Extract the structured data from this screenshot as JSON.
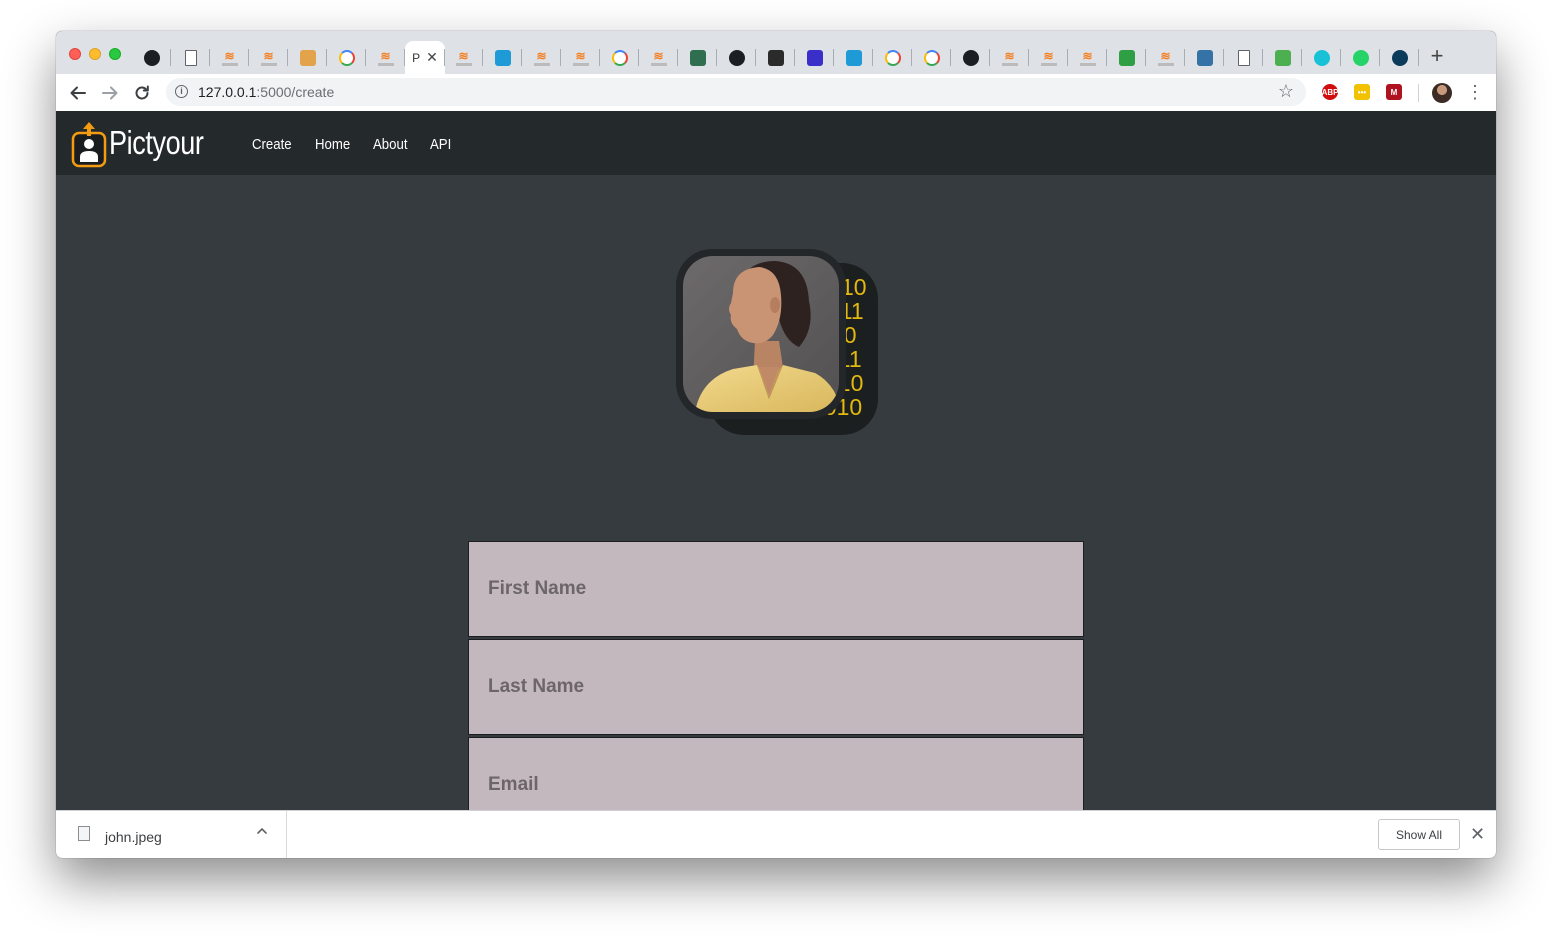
{
  "browser": {
    "active_tab_label": "P",
    "tab_close_glyph": "✕",
    "new_tab_glyph": "+",
    "tabs": [
      {
        "icon": "github-icon",
        "color": "#1b1f23"
      },
      {
        "icon": "document-icon",
        "color": "#5f6368"
      },
      {
        "icon": "stackoverflow-icon",
        "color": "#f48024"
      },
      {
        "icon": "stackoverflow-icon",
        "color": "#f48024"
      },
      {
        "icon": "note-icon",
        "color": "#e3a34a"
      },
      {
        "icon": "google-icon",
        "color": "#4285f4"
      },
      {
        "icon": "stackoverflow-icon",
        "color": "#f48024"
      },
      {
        "icon": "active-tab",
        "color": "#ffffff"
      },
      {
        "icon": "stackoverflow-icon",
        "color": "#f48024"
      },
      {
        "icon": "bird-icon",
        "color": "#1e9bd7"
      },
      {
        "icon": "stackoverflow-icon",
        "color": "#f48024"
      },
      {
        "icon": "stackoverflow-icon",
        "color": "#f48024"
      },
      {
        "icon": "google-icon",
        "color": "#4285f4"
      },
      {
        "icon": "stackoverflow-icon",
        "color": "#f48024"
      },
      {
        "icon": "diamond-icon",
        "color": "#2f6f4f"
      },
      {
        "icon": "dn-icon",
        "color": "#1b1f23"
      },
      {
        "icon": "person-icon",
        "color": "#2b2b2b"
      },
      {
        "icon": "dans-tools-icon",
        "color": "#3a2fc8"
      },
      {
        "icon": "bird-icon",
        "color": "#1e9bd7"
      },
      {
        "icon": "google-icon",
        "color": "#4285f4"
      },
      {
        "icon": "google-icon",
        "color": "#4285f4"
      },
      {
        "icon": "github-icon",
        "color": "#1b1f23"
      },
      {
        "icon": "stackoverflow-icon",
        "color": "#f48024"
      },
      {
        "icon": "stackoverflow-icon",
        "color": "#f48024"
      },
      {
        "icon": "stackoverflow-icon",
        "color": "#f48024"
      },
      {
        "icon": "b64-icon",
        "color": "#2ea043"
      },
      {
        "icon": "stackoverflow-icon",
        "color": "#f48024"
      },
      {
        "icon": "python-icon",
        "color": "#3572a5"
      },
      {
        "icon": "document-icon",
        "color": "#5f6368"
      },
      {
        "icon": "w3-icon",
        "color": "#4caf50"
      },
      {
        "icon": "circle-icon",
        "color": "#18c1d6"
      },
      {
        "icon": "whatsapp-icon",
        "color": "#25d366"
      },
      {
        "icon": "d-icon",
        "color": "#0b3b5a"
      }
    ],
    "url_host": "127.0.0.1",
    "url_rest": ":5000/create",
    "extensions": [
      {
        "icon": "adblock-icon",
        "label": "ABP",
        "color": "#d10d0d"
      },
      {
        "icon": "dots-extension-icon",
        "label": "•••",
        "color": "#f2c200"
      },
      {
        "icon": "m-extension-icon",
        "label": "M",
        "color": "#b0121f"
      }
    ]
  },
  "site": {
    "brand": "Pictyour",
    "nav": [
      {
        "label": "Create"
      },
      {
        "label": "Home"
      },
      {
        "label": "About"
      },
      {
        "label": "API"
      }
    ],
    "binary_text": [
      "10",
      "011",
      "00",
      "011",
      "010",
      "1010"
    ],
    "form": {
      "first_name_placeholder": "First Name",
      "last_name_placeholder": "Last Name",
      "email_placeholder": "Email"
    },
    "colors": {
      "nav_bg": "#24292b",
      "content_bg": "#353b3e",
      "field_bg": "#c2b8be",
      "accent_orange": "#f39c12",
      "binary_yellow": "#e3b80f"
    }
  },
  "downloads": {
    "file_name": "john.jpeg",
    "show_all_label": "Show All",
    "close_glyph": "✕",
    "caret_glyph": "^"
  }
}
